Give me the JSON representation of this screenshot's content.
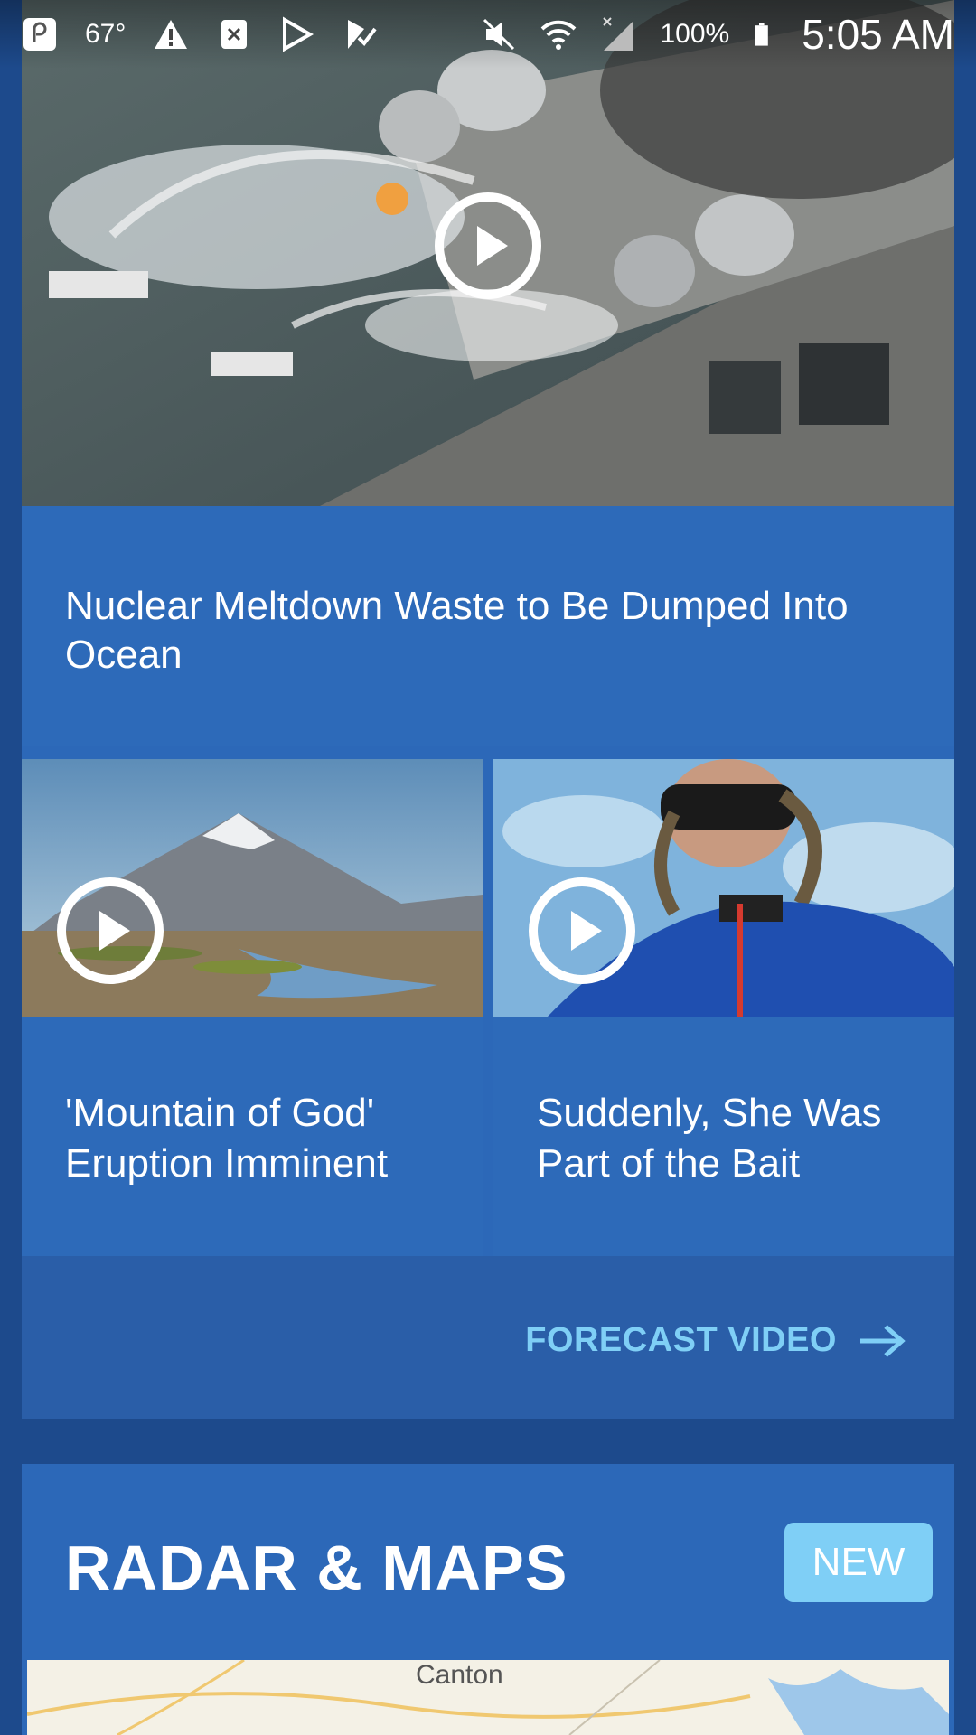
{
  "status_bar": {
    "temperature": "67°",
    "battery": "100%",
    "time": "5:05 AM"
  },
  "hero": {
    "title": "Nuclear Meltdown Waste to Be Dumped Into Ocean"
  },
  "videos": [
    {
      "title": "'Mountain of God' Eruption Imminent"
    },
    {
      "title": "Suddenly, She Was Part of the Bait"
    }
  ],
  "forecast": {
    "link_label": "FORECAST VIDEO"
  },
  "radar": {
    "title": "RADAR & MAPS",
    "badge": "NEW",
    "map_label": "Canton"
  },
  "colors": {
    "background": "#1d4a8c",
    "card": "#2c68b8",
    "accent": "#7fcff6"
  }
}
